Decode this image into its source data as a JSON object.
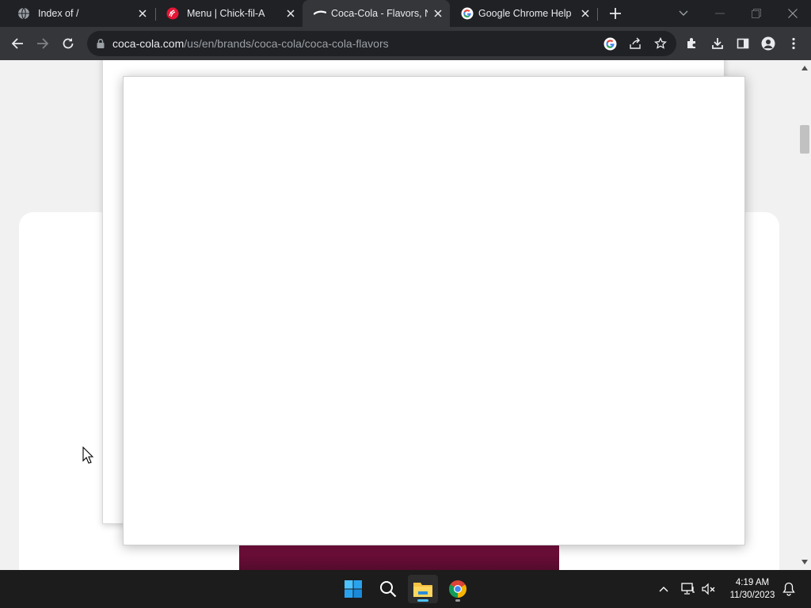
{
  "browser": {
    "tabs": [
      {
        "title": "Index of /",
        "favicon": "globe-icon",
        "active": false
      },
      {
        "title": "Menu | Chick-fil-A",
        "favicon": "chick-fil-a-icon",
        "active": false
      },
      {
        "title": "Coca-Cola - Flavors, Nu",
        "favicon": "coca-cola-icon",
        "active": true
      },
      {
        "title": "Google Chrome Help",
        "favicon": "google-icon",
        "active": false
      }
    ],
    "address_bar": {
      "host": "coca-cola.com",
      "path": "/us/en/brands/coca-cola/coca-cola-flavors"
    }
  },
  "taskbar": {
    "apps": [
      "windows-start-icon",
      "search-icon",
      "file-explorer-icon",
      "chrome-icon"
    ],
    "clock": {
      "time": "4:19 AM",
      "date": "11/30/2023"
    }
  },
  "colors": {
    "tabstrip": "#202124",
    "toolbar": "#35363a",
    "page_bg": "#f1f1f1",
    "taskbar": "#1c1c1c",
    "accent": "#4cc2ff"
  }
}
